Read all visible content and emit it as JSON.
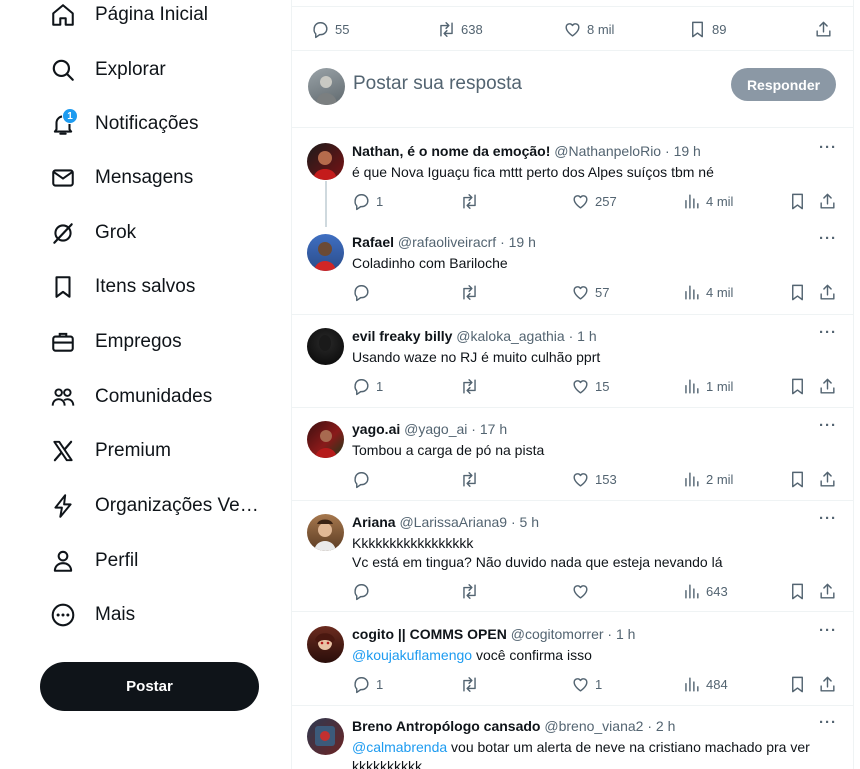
{
  "sidebar": {
    "items": [
      {
        "label": "Página Inicial",
        "icon": "home-icon"
      },
      {
        "label": "Explorar",
        "icon": "search-icon"
      },
      {
        "label": "Notificações",
        "icon": "bell-icon",
        "badge": "1"
      },
      {
        "label": "Mensagens",
        "icon": "mail-icon"
      },
      {
        "label": "Grok",
        "icon": "grok-icon"
      },
      {
        "label": "Itens salvos",
        "icon": "bookmark-icon"
      },
      {
        "label": "Empregos",
        "icon": "briefcase-icon"
      },
      {
        "label": "Comunidades",
        "icon": "people-icon"
      },
      {
        "label": "Premium",
        "icon": "x-logo-icon"
      },
      {
        "label": "Organizações Ve…",
        "icon": "lightning-icon"
      },
      {
        "label": "Perfil",
        "icon": "person-icon"
      },
      {
        "label": "Mais",
        "icon": "more-circle-icon"
      }
    ],
    "post_button": "Postar"
  },
  "main_tweet_stats": {
    "replies": "55",
    "reposts": "638",
    "likes": "8 mil",
    "bookmarks": "89"
  },
  "composer": {
    "placeholder": "Postar sua resposta",
    "reply_button": "Responder"
  },
  "tweets": [
    {
      "name": "Nathan, é o nome da emoção!",
      "handle": "@NathanpeloRio",
      "time": "19 h",
      "lines": [
        [
          {
            "t": "é que Nova Iguaçu fica mttt perto dos Alpes suíços tbm né"
          }
        ]
      ],
      "replies": "1",
      "reposts": "",
      "likes": "257",
      "views": "4 mil"
    },
    {
      "name": "Rafael",
      "handle": "@rafaoliveiracrf",
      "time": "19 h",
      "lines": [
        [
          {
            "t": "Coladinho com Bariloche"
          }
        ]
      ],
      "replies": "",
      "reposts": "",
      "likes": "57",
      "views": "4 mil"
    },
    {
      "name": "evil freaky billy",
      "handle": "@kaloka_agathia",
      "time": "1 h",
      "lines": [
        [
          {
            "t": "Usando waze no RJ é muito culhão pprt"
          }
        ]
      ],
      "replies": "1",
      "reposts": "",
      "likes": "15",
      "views": "1 mil"
    },
    {
      "name": "yago.ai",
      "handle": "@yago_ai",
      "time": "17 h",
      "lines": [
        [
          {
            "t": "Tombou a carga de pó na pista"
          }
        ]
      ],
      "replies": "",
      "reposts": "",
      "likes": "153",
      "views": "2 mil"
    },
    {
      "name": "Ariana",
      "handle": "@LarissaAriana9",
      "time": "5 h",
      "lines": [
        [
          {
            "t": "Kkkkkkkkkkkkkkkkk"
          }
        ],
        [
          {
            "t": "Vc está em tingua? Não duvido nada que esteja nevando lá"
          }
        ]
      ],
      "replies": "",
      "reposts": "",
      "likes": "",
      "views": "643"
    },
    {
      "name": "cogito || COMMS OPEN",
      "handle": "@cogitomorrer",
      "time": "1 h",
      "lines": [
        [
          {
            "t": "@koujakuflamengo",
            "m": true
          },
          {
            "t": " você confirma isso"
          }
        ]
      ],
      "replies": "1",
      "reposts": "",
      "likes": "1",
      "views": "484"
    },
    {
      "name": "Breno Antropólogo cansado",
      "handle": "@breno_viana2",
      "time": "2 h",
      "lines": [
        [
          {
            "t": "@calmabrenda",
            "m": true
          },
          {
            "t": " vou botar um alerta de neve na cristiano machado pra ver"
          }
        ],
        [
          {
            "t": "kkkkkkkkkk"
          }
        ]
      ],
      "replies": "",
      "reposts": "",
      "likes": "",
      "views": ""
    }
  ],
  "colors": {
    "accent": "#1d9bf0",
    "text": "#0f1419",
    "muted": "#536471",
    "reply_button": "#8b98a5"
  }
}
